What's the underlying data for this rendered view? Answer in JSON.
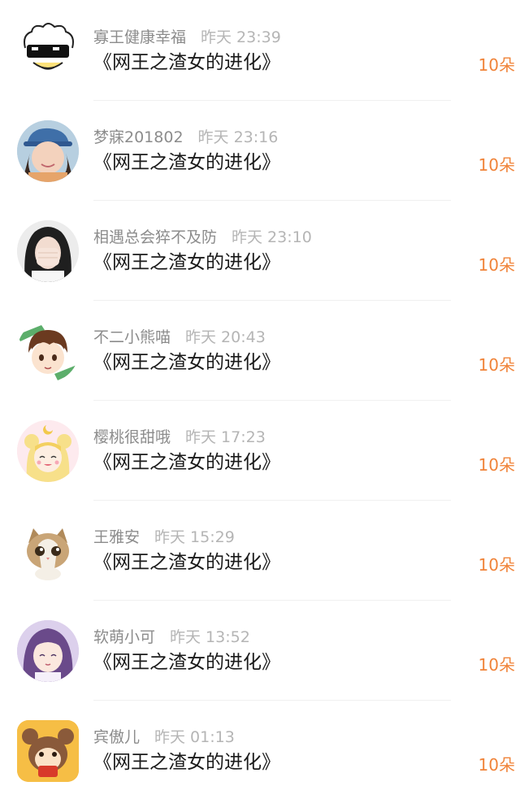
{
  "gifts": [
    {
      "user": "寡王健康幸福",
      "time": "昨天 23:39",
      "title": "《网王之渣女的进化》",
      "amount": "10朵",
      "avatar": "sunglasses-sheep-avatar"
    },
    {
      "user": "梦寐201802",
      "time": "昨天 23:16",
      "title": "《网王之渣女的进化》",
      "amount": "10朵",
      "avatar": "girl-cap-photo-avatar"
    },
    {
      "user": "相遇总会猝不及防",
      "time": "昨天 23:10",
      "title": "《网王之渣女的进化》",
      "amount": "10朵",
      "avatar": "girl-hiding-face-avatar"
    },
    {
      "user": "不二小熊喵",
      "time": "昨天 20:43",
      "title": "《网王之渣女的进化》",
      "amount": "10朵",
      "avatar": "anime-boy-avatar"
    },
    {
      "user": "樱桃很甜哦",
      "time": "昨天 17:23",
      "title": "《网王之渣女的进化》",
      "amount": "10朵",
      "avatar": "sailor-moon-avatar"
    },
    {
      "user": "王雅安",
      "time": "昨天 15:29",
      "title": "《网王之渣女的进化》",
      "amount": "10朵",
      "avatar": "kitten-avatar"
    },
    {
      "user": "软萌小可",
      "time": "昨天 13:52",
      "title": "《网王之渣女的进化》",
      "amount": "10朵",
      "avatar": "anime-girl-purple-hair-avatar"
    },
    {
      "user": "宾傲儿",
      "time": "昨天 01:13",
      "title": "《网王之渣女的进化》",
      "amount": "10朵",
      "avatar": "cartoon-rat-avatar"
    }
  ],
  "colors": {
    "amount": "#f0843a",
    "name": "#8c8c8c",
    "time": "#b5b5b5",
    "title": "#1a1a1a"
  }
}
